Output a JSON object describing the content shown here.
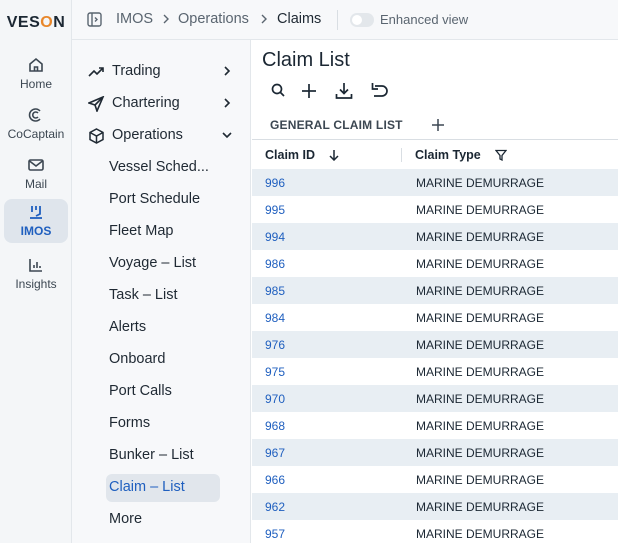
{
  "brand": {
    "logo_prefix": "VES",
    "logo_o": "O",
    "logo_suffix": "N"
  },
  "rail": [
    {
      "label": "Home",
      "icon": "home-icon"
    },
    {
      "label": "CoCaptain",
      "icon": "cocaptain-icon"
    },
    {
      "label": "Mail",
      "icon": "mail-icon"
    },
    {
      "label": "IMOS",
      "icon": "imos-icon",
      "active": true
    },
    {
      "label": "Insights",
      "icon": "insights-icon"
    }
  ],
  "breadcrumb": {
    "root": "IMOS",
    "section": "Operations",
    "current": "Claims"
  },
  "enhanced_view": {
    "label": "Enhanced view",
    "enabled": false
  },
  "nav": {
    "groups": [
      {
        "label": "Trading",
        "icon": "trading-icon",
        "expanded": false
      },
      {
        "label": "Chartering",
        "icon": "chartering-icon",
        "expanded": false
      },
      {
        "label": "Operations",
        "icon": "operations-icon",
        "expanded": true
      }
    ],
    "items": [
      "Vessel Sched...",
      "Port Schedule",
      "Fleet Map",
      "Voyage  – List",
      "Task  – List",
      "Alerts",
      "Onboard",
      "Port Calls",
      "Forms",
      "Bunker  – List",
      "Claim  – List",
      "More"
    ],
    "active_item": "Claim  – List"
  },
  "main": {
    "title": "Claim List",
    "toolbar": [
      "search-icon",
      "add-icon",
      "download-icon",
      "undo-icon"
    ],
    "tab": "GENERAL CLAIM LIST",
    "columns": {
      "claim_id": "Claim ID",
      "claim_type": "Claim Type"
    },
    "rows": [
      {
        "id": "996",
        "type": "MARINE DEMURRAGE"
      },
      {
        "id": "995",
        "type": "MARINE DEMURRAGE"
      },
      {
        "id": "994",
        "type": "MARINE DEMURRAGE"
      },
      {
        "id": "986",
        "type": "MARINE DEMURRAGE"
      },
      {
        "id": "985",
        "type": "MARINE DEMURRAGE"
      },
      {
        "id": "984",
        "type": "MARINE DEMURRAGE"
      },
      {
        "id": "976",
        "type": "MARINE DEMURRAGE"
      },
      {
        "id": "975",
        "type": "MARINE DEMURRAGE"
      },
      {
        "id": "970",
        "type": "MARINE DEMURRAGE"
      },
      {
        "id": "968",
        "type": "MARINE DEMURRAGE"
      },
      {
        "id": "967",
        "type": "MARINE DEMURRAGE"
      },
      {
        "id": "966",
        "type": "MARINE DEMURRAGE"
      },
      {
        "id": "962",
        "type": "MARINE DEMURRAGE"
      },
      {
        "id": "957",
        "type": "MARINE DEMURRAGE"
      }
    ]
  },
  "colors": {
    "accent": "#1f5fbf",
    "brand_o": "#e8872b",
    "row_stripe": "#e8eef3"
  }
}
